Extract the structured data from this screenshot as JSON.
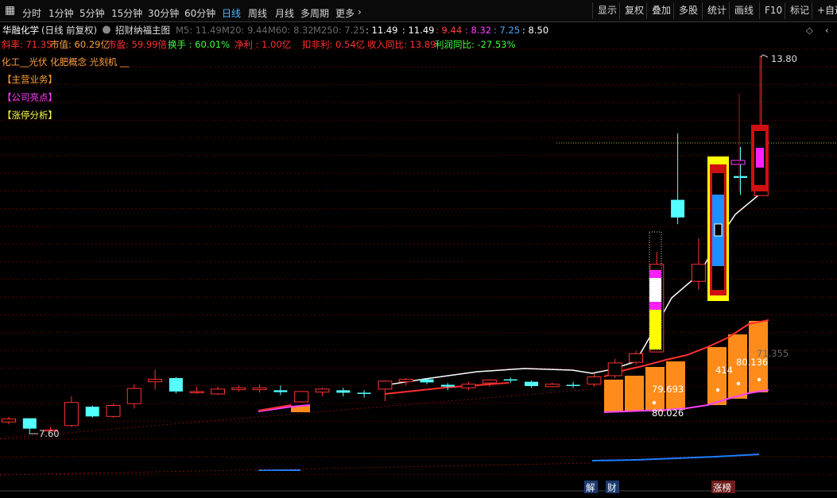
{
  "toolbar": {
    "periods": [
      {
        "label": "分时"
      },
      {
        "label": "1分钟"
      },
      {
        "label": "5分钟"
      },
      {
        "label": "15分钟"
      },
      {
        "label": "30分钟"
      },
      {
        "label": "60分钟"
      },
      {
        "label": "日线",
        "active": true
      },
      {
        "label": "周线"
      },
      {
        "label": "月线"
      },
      {
        "label": "多周期"
      },
      {
        "label": "更多"
      }
    ],
    "right_buttons": [
      {
        "label": "显示"
      },
      {
        "label": "复权"
      },
      {
        "label": "叠加"
      },
      {
        "label": "多股"
      },
      {
        "label": "统计"
      },
      {
        "label": "画线"
      },
      {
        "label": "F10"
      },
      {
        "label": "标记"
      },
      {
        "label": "+自选"
      }
    ]
  },
  "header": {
    "stock": "华融化学",
    "mode": "(日线 前复权)",
    "formula": "招财纳福主图",
    "ma": [
      {
        "label": "M5: 11.49",
        "color": "#6a6a6a"
      },
      {
        "label": "M20: 9.44",
        "color": "#6a6a6a"
      },
      {
        "label": "M60: 8.32",
        "color": "#6a6a6a"
      },
      {
        "label": "M250: 7.25",
        "color": "#6a6a6a"
      },
      {
        "label": ": 11.49",
        "color": "#ffffff"
      },
      {
        "label": ": 11.49",
        "color": "#ffffff"
      },
      {
        "label": ": 9.44",
        "color": "#ff4040"
      },
      {
        "label": ": 8.32",
        "color": "#ff40ff"
      },
      {
        "label": ": 7.25",
        "color": "#4da6ff"
      },
      {
        "label": ": 8.50",
        "color": "#ffffff"
      }
    ]
  },
  "stats": [
    {
      "label": "斜率: 71.35",
      "color": "#ff3030"
    },
    {
      "label": "市值: 60.29亿",
      "color": "#ffa040"
    },
    {
      "label": "市盈: 59.99倍",
      "color": "#ff3030"
    },
    {
      "label": "换手 : 60.01%",
      "color": "#40ff40"
    },
    {
      "label": "净利 : 1.00亿",
      "color": "#ff3030"
    },
    {
      "label": "扣非利: 0.54亿",
      "color": "#ff3030"
    },
    {
      "label": "收入同比: 13.89",
      "color": "#ff3030"
    },
    {
      "label": "利润同比: -27.53%",
      "color": "#40ff40"
    }
  ],
  "concepts": "化工__光伏 化肥概念 光刻机 __",
  "tags": [
    {
      "label": "【主营业务】",
      "color": "#ffa030"
    },
    {
      "label": "【公司亮点】",
      "color": "#ff40ff"
    },
    {
      "label": "【涨停分析】",
      "color": "#ffff40"
    }
  ],
  "markers": {
    "high": "13.80",
    "low": "7.60",
    "right_value": "71.355"
  },
  "bar_labels": [
    {
      "text": "79.693"
    },
    {
      "text": "414"
    },
    {
      "text": "80.136"
    },
    {
      "text": "80.026"
    }
  ],
  "bottom_labels": [
    "解",
    "财",
    "涨榜"
  ],
  "colors": {
    "up": "#ff3232",
    "down": "#54ffff",
    "ma5": "#ffffff",
    "ma20": "#ff3030",
    "grid": "#5a0000",
    "volume": "#ff8c1a",
    "ma250": "#1e7fff"
  },
  "chart_data": {
    "type": "candlestick",
    "y_axis_prices": [
      7.6,
      13.8
    ],
    "candles": [
      {
        "o": 7.78,
        "c": 7.83,
        "h": 7.86,
        "l": 7.74
      },
      {
        "o": 7.84,
        "c": 7.67,
        "h": 7.84,
        "l": 7.6
      },
      {
        "o": 7.65,
        "c": 7.65,
        "h": 7.7,
        "l": 7.62
      },
      {
        "o": 7.72,
        "c": 8.1,
        "h": 8.2,
        "l": 7.7
      },
      {
        "o": 8.03,
        "c": 7.87,
        "h": 8.05,
        "l": 7.85
      },
      {
        "o": 7.87,
        "c": 8.05,
        "h": 8.08,
        "l": 7.85
      },
      {
        "o": 8.08,
        "c": 8.33,
        "h": 8.4,
        "l": 8.0
      },
      {
        "o": 8.44,
        "c": 8.48,
        "h": 8.64,
        "l": 8.31
      },
      {
        "o": 8.5,
        "c": 8.28,
        "h": 8.52,
        "l": 8.25
      },
      {
        "o": 8.26,
        "c": 8.28,
        "h": 8.36,
        "l": 8.24
      },
      {
        "o": 8.24,
        "c": 8.32,
        "h": 8.36,
        "l": 8.22
      },
      {
        "o": 8.31,
        "c": 8.34,
        "h": 8.38,
        "l": 8.28
      },
      {
        "o": 8.31,
        "c": 8.34,
        "h": 8.4,
        "l": 8.26
      },
      {
        "o": 8.3,
        "c": 8.27,
        "h": 8.38,
        "l": 8.22
      },
      {
        "o": 8.11,
        "c": 8.28,
        "h": 8.29,
        "l": 8.1
      },
      {
        "o": 8.27,
        "c": 8.32,
        "h": 8.34,
        "l": 8.2
      },
      {
        "o": 8.3,
        "c": 8.26,
        "h": 8.34,
        "l": 8.2
      },
      {
        "o": 8.26,
        "c": 8.24,
        "h": 8.3,
        "l": 8.18
      },
      {
        "o": 8.32,
        "c": 8.45,
        "h": 8.46,
        "l": 8.12
      },
      {
        "o": 8.44,
        "c": 8.48,
        "h": 8.5,
        "l": 8.38
      },
      {
        "o": 8.48,
        "c": 8.43,
        "h": 8.49,
        "l": 8.4
      },
      {
        "o": 8.39,
        "c": 8.36,
        "h": 8.42,
        "l": 8.3
      },
      {
        "o": 8.34,
        "c": 8.4,
        "h": 8.44,
        "l": 8.3
      },
      {
        "o": 8.42,
        "c": 8.47,
        "h": 8.48,
        "l": 8.36
      },
      {
        "o": 8.48,
        "c": 8.46,
        "h": 8.51,
        "l": 8.42
      },
      {
        "o": 8.44,
        "c": 8.37,
        "h": 8.46,
        "l": 8.34
      },
      {
        "o": 8.36,
        "c": 8.4,
        "h": 8.43,
        "l": 8.35
      },
      {
        "o": 8.39,
        "c": 8.38,
        "h": 8.44,
        "l": 8.34
      },
      {
        "o": 8.4,
        "c": 8.52,
        "h": 8.58,
        "l": 8.36
      },
      {
        "o": 8.54,
        "c": 8.75,
        "h": 8.82,
        "l": 8.5
      },
      {
        "o": 8.76,
        "c": 8.9,
        "h": 8.95,
        "l": 8.72
      },
      {
        "o": 8.93,
        "c": 10.37,
        "h": 10.57,
        "l": 8.93
      },
      {
        "o": 11.43,
        "c": 11.14,
        "h": 12.52,
        "l": 11.03
      },
      {
        "o": 10.09,
        "c": 10.37,
        "h": 10.8,
        "l": 9.95
      },
      {
        "o": 11.7,
        "c": 10.3,
        "h": 11.7,
        "l": 10.26
      },
      {
        "o": 11.82,
        "c": 11.79,
        "h": 12.3,
        "l": 11.51
      },
      {
        "o": 11.5,
        "c": 11.93,
        "h": 13.8,
        "l": 11.5
      }
    ]
  }
}
